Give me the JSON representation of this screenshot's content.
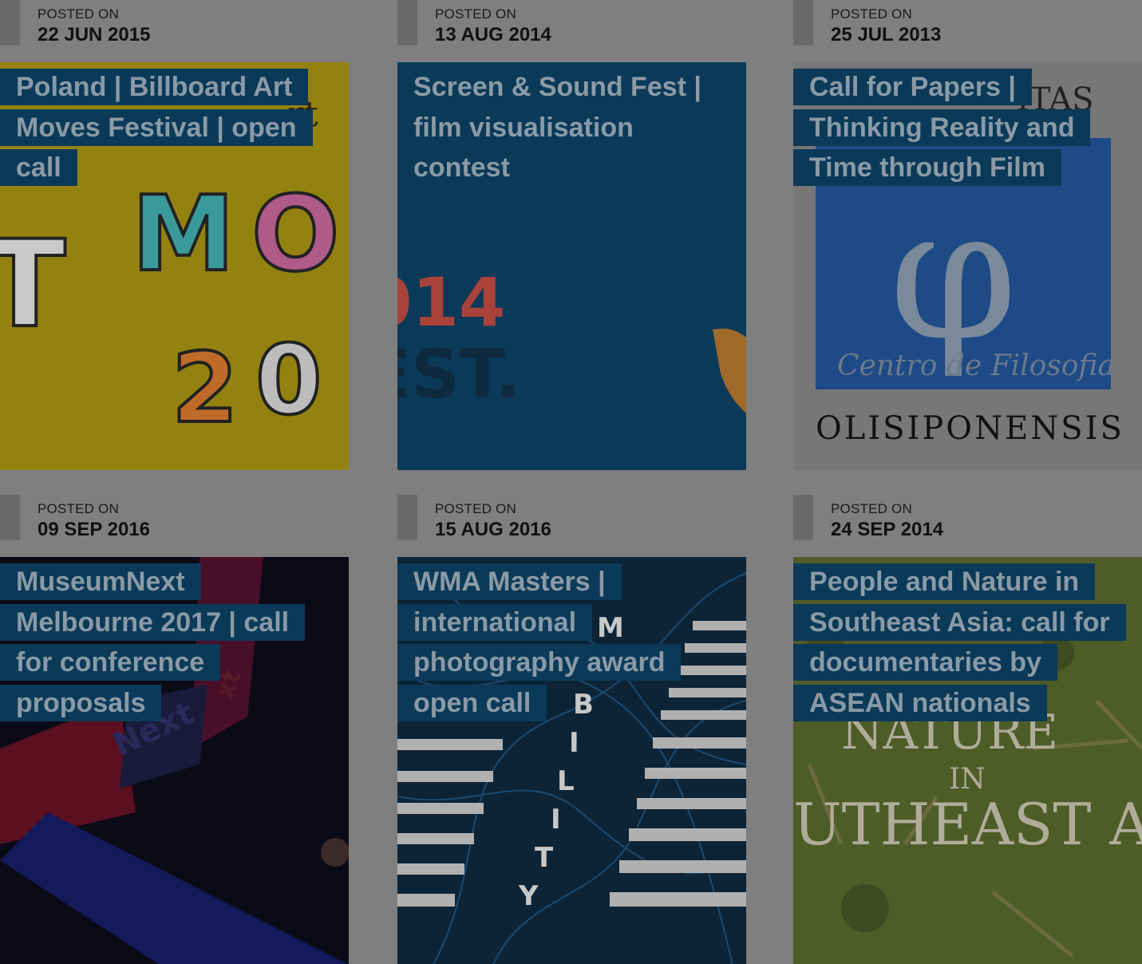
{
  "posts": [
    {
      "posted_label": "POSTED ON",
      "date": "22 JUN 2015",
      "title": "Poland | Billboard Art Moves Festival | open call",
      "image_text": [
        "rt",
        "M O",
        "2 0"
      ]
    },
    {
      "posted_label": "POSTED ON",
      "date": "13 AUG 2014",
      "title": "Screen & Sound Fest | film visualisation contest",
      "image_text": [
        "014",
        "EST."
      ]
    },
    {
      "posted_label": "POSTED ON",
      "date": "25 JUL 2013",
      "title": "Call for Papers | Thinking Reality and Time through Film",
      "image_text": [
        "ITAS",
        "φ",
        "Centro de Filosofia",
        "OLISIPONENSIS"
      ]
    },
    {
      "posted_label": "POSTED ON",
      "date": "09 SEP 2016",
      "title": "MuseumNext Melbourne 2017 | call for conference proposals",
      "image_text": [
        "Next",
        "xt"
      ]
    },
    {
      "posted_label": "POSTED ON",
      "date": "15 AUG 2016",
      "title": "WMA Masters | international photography award open call",
      "image_text": [
        "M",
        "B",
        "I",
        "L",
        "I",
        "T",
        "Y"
      ]
    },
    {
      "posted_label": "POSTED ON",
      "date": "24 SEP 2014",
      "title": "People and Nature in Southeast Asia: call for documentaries by ASEAN nationals",
      "image_text": [
        "NATURE",
        "IN",
        "UTHEAST AS"
      ]
    }
  ],
  "colors": {
    "overlay": "#7f7f7f",
    "title_bg": "#0b3a59",
    "title_text": "#8a9aa6"
  }
}
